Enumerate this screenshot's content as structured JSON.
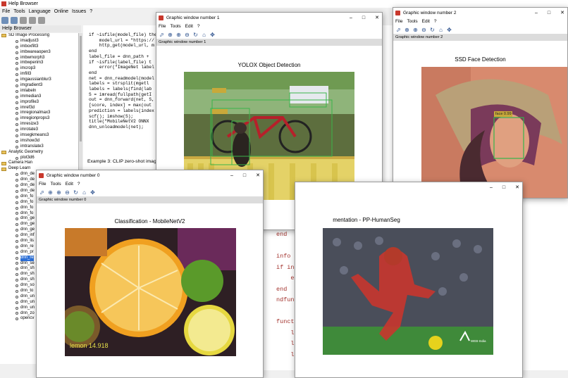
{
  "help_browser": {
    "title": "Help Browser",
    "menu": [
      "File",
      "Tools",
      "Language",
      "Online",
      "Issues",
      "?"
    ],
    "panel_label": "Help Browser",
    "tree": [
      {
        "label": "SD Image Processing",
        "level": 0,
        "folder": true
      },
      {
        "label": "imadjust3",
        "level": 1
      },
      {
        "label": "imboxfilt3",
        "level": 1
      },
      {
        "label": "imbwareaopen3",
        "level": 1
      },
      {
        "label": "imbwmorph3",
        "level": 1
      },
      {
        "label": "imbwperim3",
        "level": 1
      },
      {
        "label": "imcrop3",
        "level": 1
      },
      {
        "label": "imfill3",
        "level": 1
      },
      {
        "label": "imgaussianblur3",
        "level": 1
      },
      {
        "label": "imgradient3",
        "level": 1
      },
      {
        "label": "imlabeln",
        "level": 1
      },
      {
        "label": "immedian3",
        "level": 1
      },
      {
        "label": "improfile3",
        "level": 1
      },
      {
        "label": "imref3d",
        "level": 1
      },
      {
        "label": "imregionalmax3",
        "level": 1
      },
      {
        "label": "imregionprops3",
        "level": 1
      },
      {
        "label": "imresize3",
        "level": 1
      },
      {
        "label": "imrotate3",
        "level": 1
      },
      {
        "label": "imsegkmeans3",
        "level": 1
      },
      {
        "label": "imshow3d",
        "level": 1
      },
      {
        "label": "imtranslate3",
        "level": 1
      },
      {
        "label": "Analytic Geometry",
        "level": 0,
        "folder": true
      },
      {
        "label": "plot3d6",
        "level": 1
      },
      {
        "label": "Camera Han",
        "level": 0,
        "folder": true
      },
      {
        "label": "Deep Learn",
        "level": 0,
        "folder": true
      },
      {
        "label": "dnn_de",
        "level": 1
      },
      {
        "label": "dnn_de",
        "level": 1
      },
      {
        "label": "dnn_de",
        "level": 1
      },
      {
        "label": "dnn_de",
        "level": 1
      },
      {
        "label": "dnn_fo",
        "level": 1
      },
      {
        "label": "dnn_fo",
        "level": 1
      },
      {
        "label": "dnn_fo",
        "level": 1
      },
      {
        "label": "dnn_fo",
        "level": 1
      },
      {
        "label": "dnn_ge",
        "level": 1
      },
      {
        "label": "dnn_ge",
        "level": 1
      },
      {
        "label": "dnn_ge",
        "level": 1
      },
      {
        "label": "dnn_inf",
        "level": 1
      },
      {
        "label": "dnn_lis",
        "level": 1
      },
      {
        "label": "dnn_re",
        "level": 1
      },
      {
        "label": "dnn_pr",
        "level": 1
      },
      {
        "label": "dnn_re",
        "level": 1,
        "selected": true
      },
      {
        "label": "dnn_se",
        "level": 1
      },
      {
        "label": "dnn_sh",
        "level": 1
      },
      {
        "label": "dnn_sh",
        "level": 1
      },
      {
        "label": "dnn_sh",
        "level": 1
      },
      {
        "label": "dnn_so",
        "level": 1
      },
      {
        "label": "dnn_to",
        "level": 1
      },
      {
        "label": "dnn_un",
        "level": 1
      },
      {
        "label": "dnn_un",
        "level": 1
      },
      {
        "label": "dnn_un",
        "level": 1
      },
      {
        "label": "dnn_zo",
        "level": 1
      },
      {
        "label": "opencv",
        "level": 1
      }
    ],
    "code_lines": [
      "if ~isfile(model_file) then",
      "    model_url = \"https://",
      "    http_get(model_url, m",
      "end",
      "label_file = dnn_path + ",
      "if ~isfile(label_file) t",
      "    error(\"ImageNet label",
      "end",
      "net = dnn_readmodel(model",
      "labels = strsplit(mgetl",
      "labels = labels(find(lab",
      "S = imread(fullpath(getI",
      "out = dnn_forward(net, S,",
      "[score, index] = max(out",
      "prediction = labels(index",
      "scf(); imshow(S);",
      "title(\"MobileNetV2 ONNX",
      "dnn_unloadmodel(net);"
    ],
    "example_caption": "Example 3: CLIP zero-shot image",
    "code_fragment_right": [
      "end",
      "",
      "info",
      "if in",
      "    e",
      "end",
      "ndfuncti",
      "",
      "function",
      "    label",
      "    label",
      "    label"
    ]
  },
  "windows": [
    {
      "id": "win1",
      "title": "Graphic window number 1",
      "menu": [
        "File",
        "Tools",
        "Edit",
        "?"
      ],
      "status": "Graphic window number 1",
      "plot_title": "YOLOX Object Detection"
    },
    {
      "id": "win2",
      "title": "Graphic window number 2",
      "menu": [
        "File",
        "Tools",
        "Edit",
        "?"
      ],
      "status": "Graphic window number 2",
      "plot_title": "SSD Face Detection",
      "box_label": "face 0.99"
    },
    {
      "id": "win0",
      "title": "Graphic window number 0",
      "menu": [
        "File",
        "Tools",
        "Edit",
        "?"
      ],
      "status": "Graphic window number 0",
      "plot_title": "Classification - MobileNetV2",
      "overlay_label": "lemon 14.918"
    },
    {
      "id": "win3",
      "plot_title": "mentation - PP-HumanSeg",
      "watermark": "WEB-India"
    }
  ],
  "icons": [
    "zoom-in-icon",
    "zoom-out-icon",
    "rotate-icon",
    "pan-icon",
    "datatip-icon"
  ]
}
